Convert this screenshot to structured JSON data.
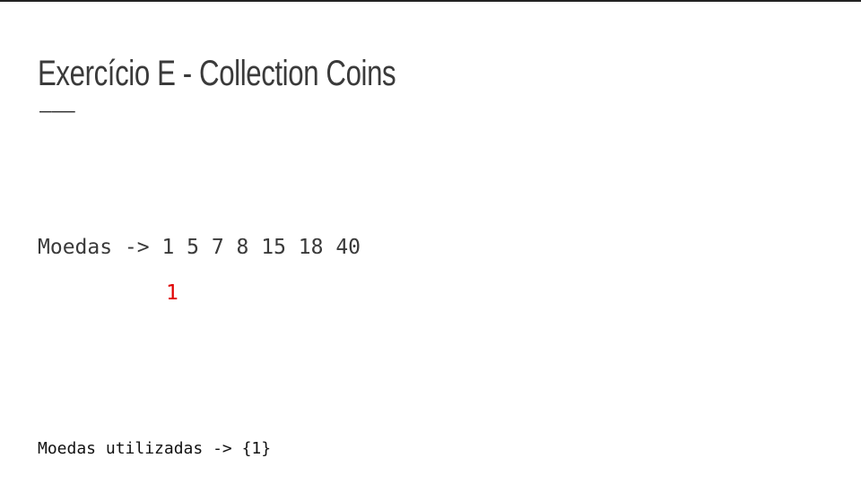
{
  "slide": {
    "title": "Exercício E - Collection Coins",
    "divider": "———",
    "coins_line": "Moedas -> 1 5 7 8 15 18 40",
    "selected_coin": "1",
    "used_line": "Moedas utilizadas -> {1}"
  },
  "colors": {
    "text": "#3a3a3a",
    "highlight": "#e00000",
    "top_rule": "#222222"
  }
}
